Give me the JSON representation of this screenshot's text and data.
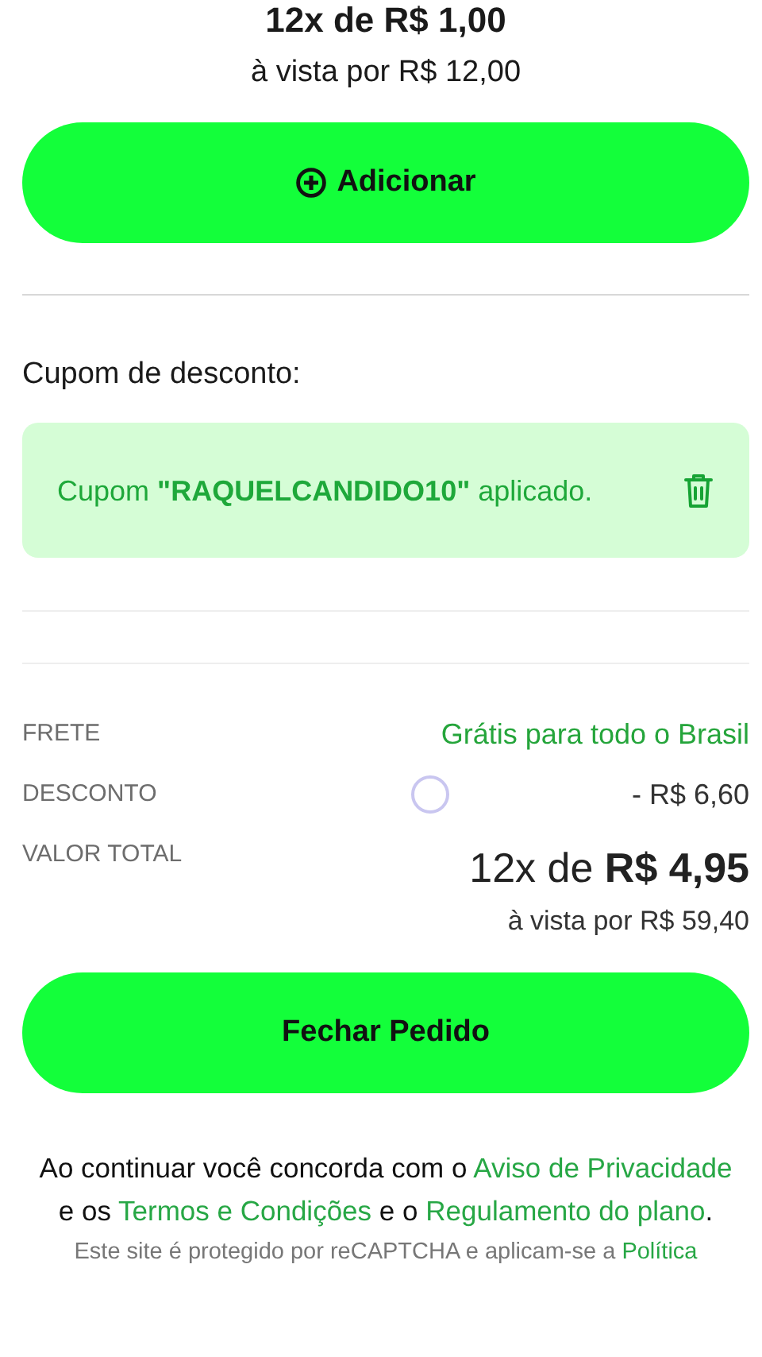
{
  "product_price": {
    "installments": "12x de R$ 1,00",
    "cash": "à vista por R$ 12,00"
  },
  "add_button": {
    "label": "Adicionar"
  },
  "coupon": {
    "title": "Cupom de desconto:",
    "message": "Cupom **\"RAQUELCANDIDO10\"** aplicado.",
    "applied": true
  },
  "summary": [
    {
      "label": "FRETE",
      "value": "Grátis para todo o Brasil",
      "kind": "highlight"
    },
    {
      "label": "DESCONTO",
      "value": "- R$ 6,60",
      "kind": "plain"
    },
    {
      "label": "VALOR TOTAL",
      "value": "12x de **R$ 4,95**",
      "subvalue": "à vista por R$ 59,40",
      "kind": "total"
    }
  ],
  "checkout_button": {
    "label": "Fechar Pedido"
  },
  "terms": [
    {
      "kind": "text",
      "text": "Ao continuar você concorda com o "
    },
    {
      "kind": "link",
      "text": "Aviso de Privacidade"
    },
    {
      "kind": "text",
      "text": " e os "
    },
    {
      "kind": "link",
      "text": "Termos e Condições"
    },
    {
      "kind": "text",
      "text": " e o "
    },
    {
      "kind": "link",
      "text": "Regulamento do plano"
    },
    {
      "kind": "text",
      "text": "."
    }
  ],
  "recaptcha": [
    {
      "kind": "text",
      "text": "Este site é protegido por reCAPTCHA e aplicam-se a "
    },
    {
      "kind": "link",
      "text": "Política"
    }
  ]
}
